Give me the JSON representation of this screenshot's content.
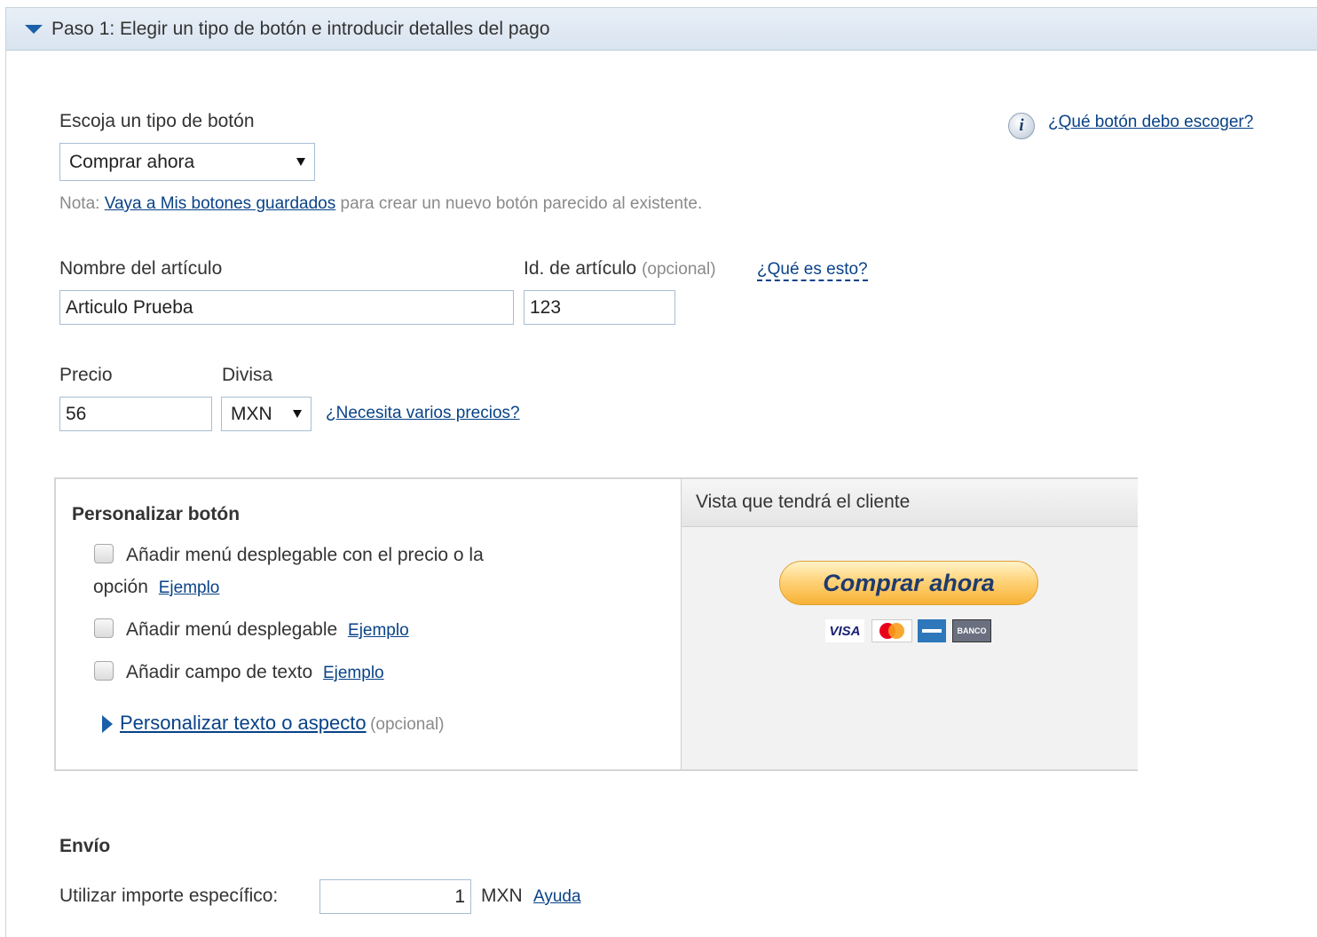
{
  "header": {
    "title": "Paso 1: Elegir un tipo de botón e introducir detalles del pago"
  },
  "button_type": {
    "label": "Escoja un tipo de botón",
    "selected": "Comprar ahora",
    "help_link": "¿Qué botón debo escoger?"
  },
  "note": {
    "prefix": "Nota:",
    "link": "Vaya a Mis botones guardados",
    "suffix": "para crear un nuevo botón parecido al existente."
  },
  "item": {
    "name_label": "Nombre del artículo",
    "name_value": "Articulo Prueba",
    "id_label": "Id. de artículo",
    "id_optional": "(opcional)",
    "id_help": "¿Qué es esto?",
    "id_value": "123"
  },
  "price": {
    "label": "Precio",
    "value": "56",
    "currency_label": "Divisa",
    "currency": "MXN",
    "multi_link": "¿Necesita varios precios?"
  },
  "customize": {
    "title": "Personalizar botón",
    "option1_line1": "Añadir menú desplegable con el precio o la",
    "option1_line2": "opción",
    "option2": "Añadir menú desplegable",
    "option3": "Añadir campo de texto",
    "example": "Ejemplo",
    "text_link": "Personalizar texto o aspecto",
    "text_optional": "(opcional)"
  },
  "preview": {
    "title": "Vista que tendrá el cliente",
    "button": "Comprar ahora",
    "cards": [
      "VISA",
      "MasterCard",
      "American Express",
      "BANCO"
    ]
  },
  "shipping": {
    "title": "Envío",
    "label": "Utilizar importe específico:",
    "value": "1",
    "currency": "MXN",
    "help": "Ayuda"
  }
}
